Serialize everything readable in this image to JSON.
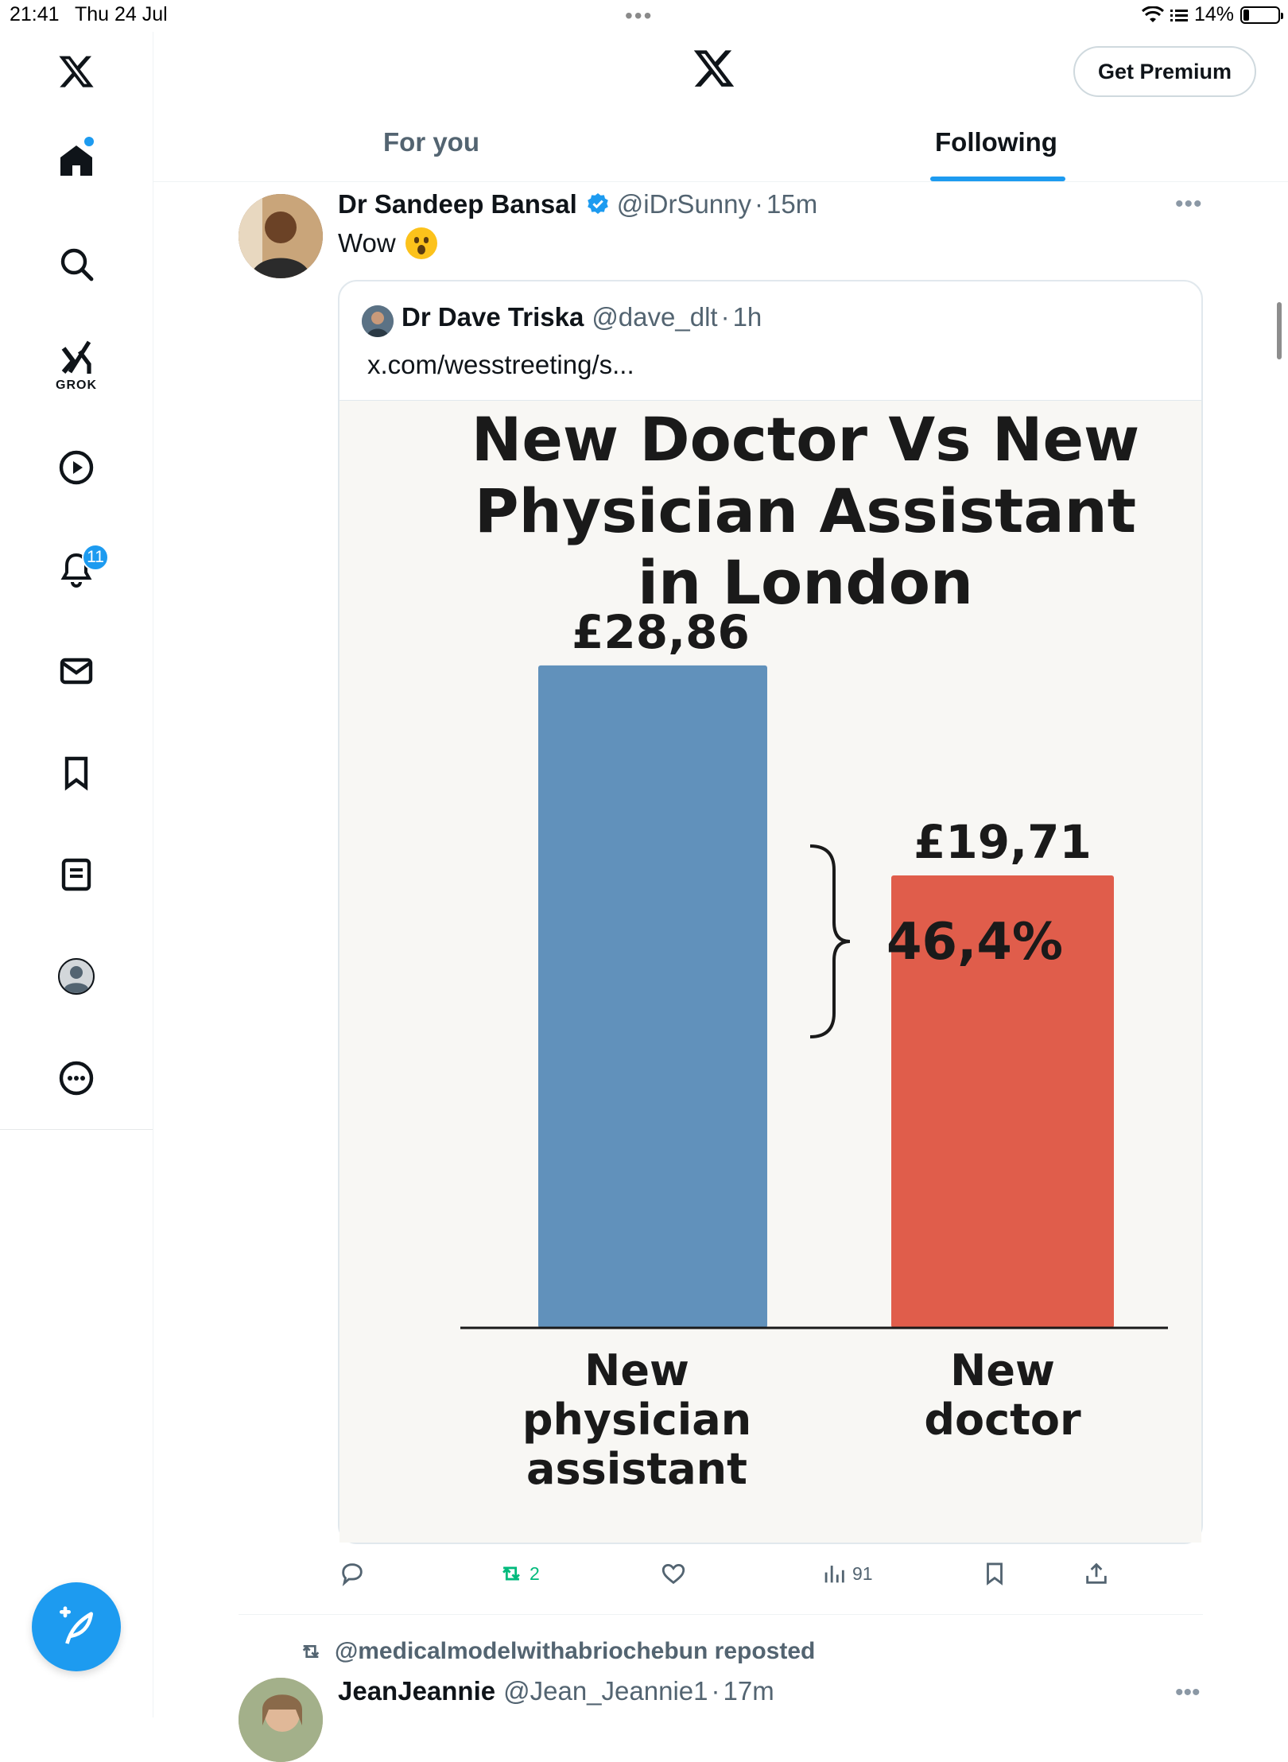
{
  "status_bar": {
    "time": "21:41",
    "date": "Thu 24 Jul",
    "dots": "•••",
    "battery": "14%"
  },
  "sidebar": {
    "items": [
      {
        "name": "home",
        "label": "Home"
      },
      {
        "name": "explore",
        "label": "Explore"
      },
      {
        "name": "grok",
        "label": "GROK"
      },
      {
        "name": "video",
        "label": "Video"
      },
      {
        "name": "notifications",
        "label": "Notifications"
      },
      {
        "name": "messages",
        "label": "Messages"
      },
      {
        "name": "bookmarks",
        "label": "Bookmarks"
      },
      {
        "name": "lists",
        "label": "Lists"
      },
      {
        "name": "profile",
        "label": "Profile"
      },
      {
        "name": "more",
        "label": "More"
      }
    ],
    "notification_count": "11",
    "grok_label": "GROK"
  },
  "header": {
    "premium_label": "Get Premium",
    "tabs": [
      {
        "label": "For you"
      },
      {
        "label": "Following"
      }
    ],
    "active_tab": "Following"
  },
  "tweet": {
    "author": "Dr Sandeep Bansal",
    "handle": "@iDrSunny",
    "sep": "·",
    "time": "15m",
    "text": "Wow",
    "more": "•••",
    "quote": {
      "author": "Dr Dave Triska",
      "handle": "@dave_dlt",
      "time": "1h",
      "link": "x.com/wesstreeting/s..."
    },
    "actions": {
      "replies": "",
      "retweets": "2",
      "likes": "",
      "views": "91"
    }
  },
  "chart_data": {
    "type": "bar",
    "title_lines": [
      "New Doctor Vs New",
      "Physician Assistant",
      "in London"
    ],
    "categories": [
      "New physician assistant",
      "New doctor"
    ],
    "category_lines": [
      [
        "New",
        "physician",
        "assistant"
      ],
      [
        "New",
        "doctor"
      ]
    ],
    "values": [
      28.86,
      19.71
    ],
    "value_labels": [
      "£28,86",
      "£19,71"
    ],
    "annotation": "46,4%",
    "colors": [
      "#6191bb",
      "#e05d4b"
    ],
    "ylim": [
      0,
      30
    ]
  },
  "next_tweet": {
    "reposted_by": "@medicalmodelwithabriochebun reposted",
    "author": "JeanJeannie",
    "handle": "@Jean_Jeannie1",
    "time": "17m",
    "more": "•••"
  }
}
